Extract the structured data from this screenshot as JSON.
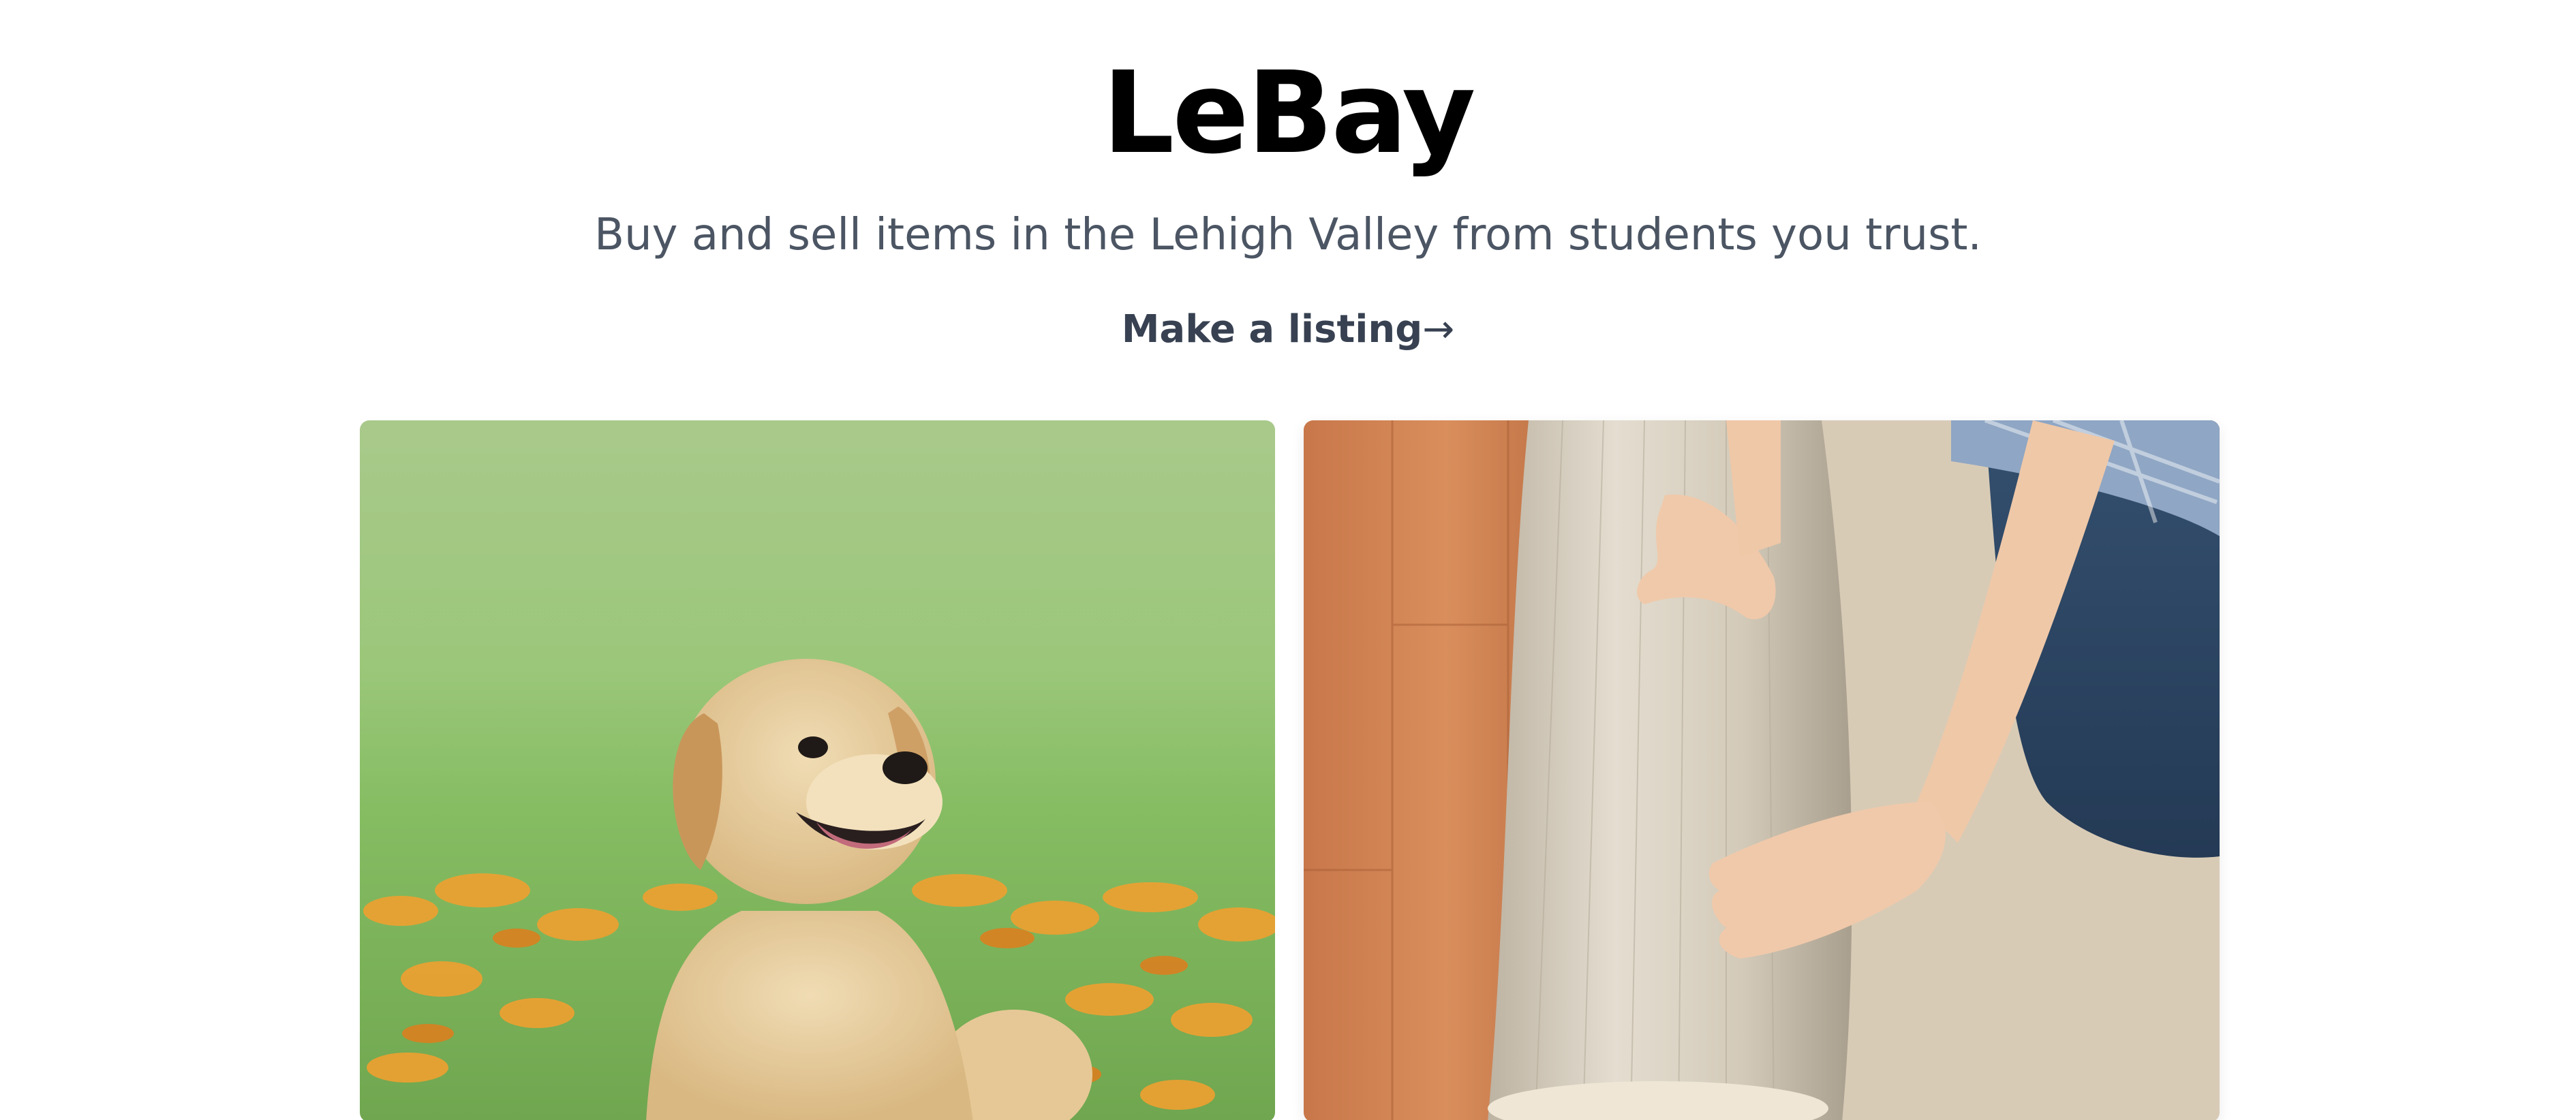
{
  "header": {
    "title": "LeBay",
    "tagline": "Buy and sell items in the Lehigh Valley from students you trust.",
    "cta_label": "Make a listing",
    "cta_arrow": "→"
  },
  "listings": [
    {
      "image": "golden-retriever-puppy-photo"
    },
    {
      "image": "rolled-carpet-photo"
    }
  ]
}
